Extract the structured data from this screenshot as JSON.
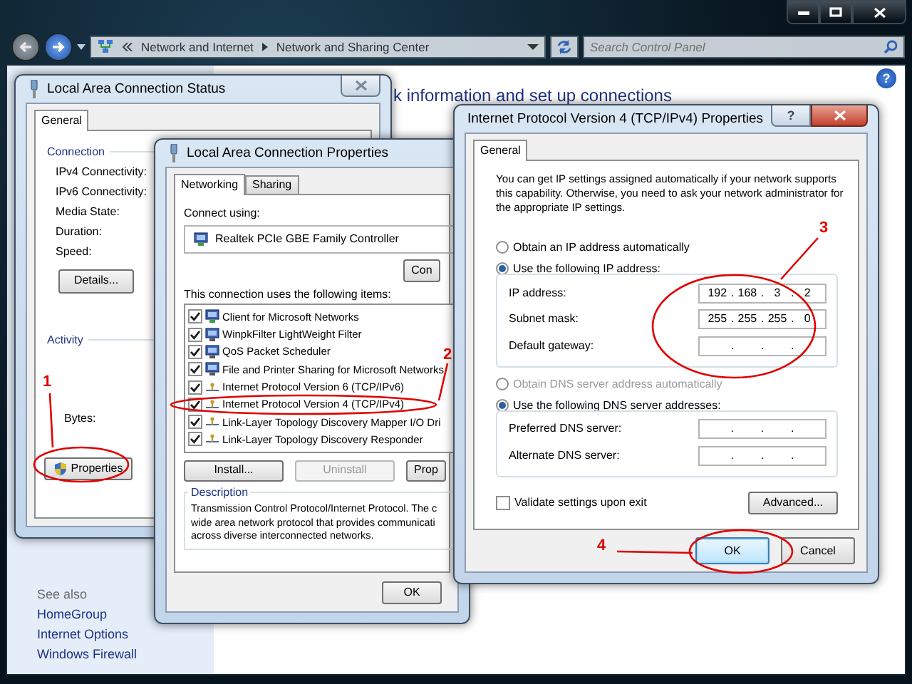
{
  "explorer": {
    "address": {
      "crumbs": [
        "Network and Internet",
        "Network and Sharing Center"
      ]
    },
    "search": {
      "placeholder": "Search Control Panel"
    },
    "heading": "k information and set up connections",
    "help": "?",
    "see_also": {
      "title": "See also",
      "links": [
        "HomeGroup",
        "Internet Options",
        "Windows Firewall"
      ]
    }
  },
  "status_dialog": {
    "title": "Local Area Connection Status",
    "tabs": [
      {
        "label": "General",
        "selected": true
      }
    ],
    "connection": {
      "title": "Connection",
      "labels": [
        "IPv4 Connectivity:",
        "IPv6 Connectivity:",
        "Media State:",
        "Duration:",
        "Speed:"
      ],
      "details_button": "Details..."
    },
    "activity": {
      "title": "Activity",
      "labels": [
        "Bytes:"
      ]
    },
    "properties_button": "Properties"
  },
  "properties_dialog": {
    "title": "Local Area Connection Properties",
    "tabs": [
      {
        "label": "Networking",
        "selected": true
      },
      {
        "label": "Sharing",
        "selected": false
      }
    ],
    "connect_using": "Connect using:",
    "adapter": "Realtek PCIe GBE Family Controller",
    "configure_button": "Con",
    "items_label": "This connection uses the following items:",
    "items": [
      {
        "label": "Client for Microsoft Networks",
        "checked": true,
        "kind": "client"
      },
      {
        "label": "WinpkFilter LightWeight Filter",
        "checked": true,
        "kind": "service"
      },
      {
        "label": "QoS Packet Scheduler",
        "checked": true,
        "kind": "service"
      },
      {
        "label": "File and Printer Sharing for Microsoft Networks",
        "checked": true,
        "kind": "service"
      },
      {
        "label": "Internet Protocol Version 6 (TCP/IPv6)",
        "checked": true,
        "kind": "protocol"
      },
      {
        "label": "Internet Protocol Version 4 (TCP/IPv4)",
        "checked": true,
        "kind": "protocol"
      },
      {
        "label": "Link-Layer Topology Discovery Mapper I/O Dri",
        "checked": true,
        "kind": "protocol"
      },
      {
        "label": "Link-Layer Topology Discovery Responder",
        "checked": true,
        "kind": "protocol"
      }
    ],
    "item_buttons": [
      {
        "label": "Install...",
        "disabled": false
      },
      {
        "label": "Uninstall",
        "disabled": true
      },
      {
        "label": "Prop",
        "disabled": false
      }
    ],
    "description": {
      "title": "Description",
      "lines": [
        "Transmission Control Protocol/Internet Protocol. The c",
        "wide area network protocol that provides communicati",
        "across diverse interconnected networks."
      ]
    },
    "ok_button": "OK"
  },
  "ipv4_dialog": {
    "title": "Internet Protocol Version 4 (TCP/IPv4) Properties",
    "help": "?",
    "tabs": [
      {
        "label": "General",
        "selected": true
      }
    ],
    "intro": "You can get IP settings assigned automatically if your network supports this capability. Otherwise, you need to ask your network administrator for the appropriate IP settings.",
    "ip_options": [
      {
        "label": "Obtain an IP address automatically",
        "selected": false,
        "disabled": false
      },
      {
        "label": "Use the following IP address:",
        "selected": true,
        "disabled": false
      }
    ],
    "ip_fields": [
      {
        "label": "IP address:",
        "octets": [
          "192",
          "168",
          "3",
          "2"
        ],
        "dots": [
          ".",
          ".",
          "."
        ]
      },
      {
        "label": "Subnet mask:",
        "octets": [
          "255",
          "255",
          "255",
          "0"
        ],
        "dots": [
          ".",
          ".",
          "."
        ]
      },
      {
        "label": "Default gateway:",
        "dots": [
          ".",
          ".",
          "."
        ]
      }
    ],
    "dns_options": [
      {
        "label": "Obtain DNS server address automatically",
        "selected": false,
        "disabled": true
      },
      {
        "label": "Use the following DNS server addresses:",
        "selected": true,
        "disabled": false
      }
    ],
    "dns_fields": [
      {
        "label": "Preferred DNS server:",
        "dots": [
          ".",
          ".",
          "."
        ]
      },
      {
        "label": "Alternate DNS server:",
        "dots": [
          ".",
          ".",
          "."
        ]
      }
    ],
    "validate": {
      "label": "Validate settings upon exit",
      "checked": false
    },
    "advanced_button": "Advanced...",
    "buttons": [
      {
        "label": "OK",
        "default": true
      },
      {
        "label": "Cancel",
        "default": false
      }
    ]
  },
  "annotations": [
    {
      "label": "1"
    },
    {
      "label": "2"
    },
    {
      "label": "3"
    },
    {
      "label": "4"
    }
  ]
}
